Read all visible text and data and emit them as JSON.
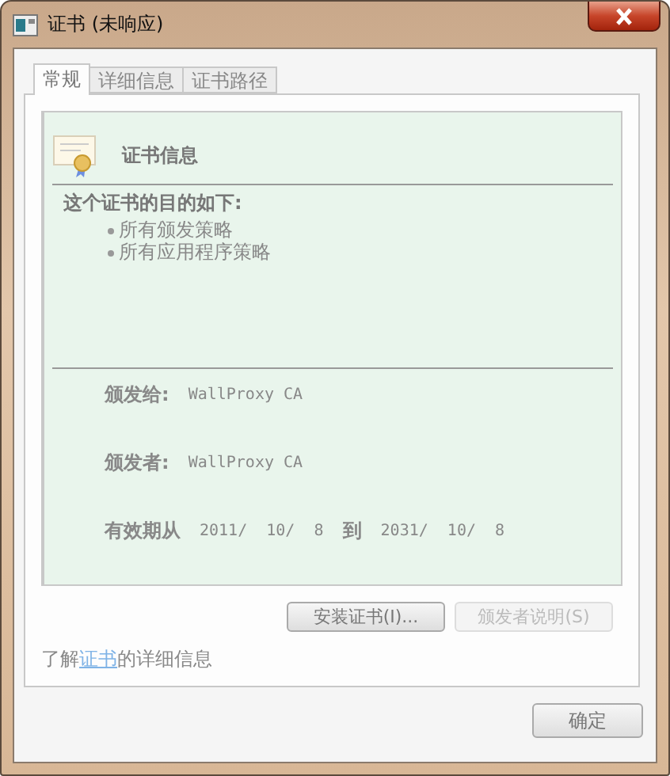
{
  "window": {
    "title": "证书 (未响应)"
  },
  "tabs": [
    {
      "label": "常规",
      "selected": true
    },
    {
      "label": "详细信息",
      "selected": false
    },
    {
      "label": "证书路径",
      "selected": false
    }
  ],
  "certificate": {
    "heading": "证书信息",
    "purpose_title": "这个证书的目的如下:",
    "purposes": [
      "所有颁发策略",
      "所有应用程序策略"
    ],
    "fields": [
      {
        "label": "颁发给:",
        "value": "WallProxy CA"
      },
      {
        "label": "颁发者:",
        "value": "WallProxy CA"
      }
    ],
    "validity": {
      "from_label": "有效期从",
      "from": "2011/  10/  8",
      "to_label": "到",
      "to": "2031/  10/  8"
    }
  },
  "buttons": [
    {
      "label": "安装证书(I)...",
      "disabled": false
    },
    {
      "label": "颁发者说明(S)",
      "disabled": true
    }
  ],
  "learn_more": {
    "before": "了解",
    "link": "证书",
    "after": "的详细信息"
  },
  "ok_button": {
    "label": "确定",
    "disabled": false
  }
}
